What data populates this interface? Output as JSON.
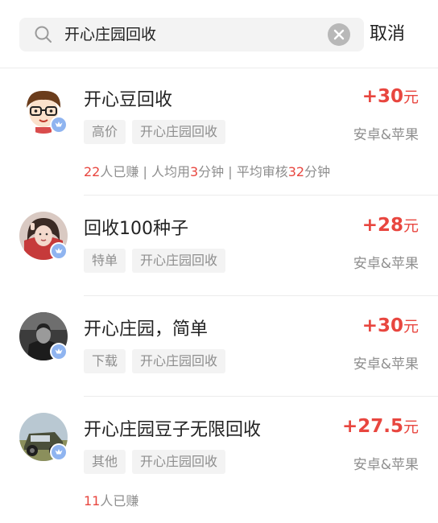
{
  "search": {
    "value": "开心庄园回收",
    "cancel_label": "取消",
    "icons": {
      "search": "search-icon",
      "clear": "clear-icon"
    }
  },
  "colors": {
    "accent": "#e8463f",
    "muted": "#8e8e8e",
    "tag_bg": "#f3f3f3",
    "badge": "#8fb4f0"
  },
  "tasks": [
    {
      "title": "开心豆回收",
      "reward": "+30",
      "reward_unit": "元",
      "tags": [
        "高价",
        "开心庄园回收"
      ],
      "platform": "安卓&苹果",
      "stats": {
        "earned_count": "22",
        "earned_suffix": "人已赚",
        "sep1": " | ",
        "avg_time_prefix": "人均用",
        "avg_time": "3",
        "avg_time_suffix": "分钟",
        "sep2": " | ",
        "review_prefix": "平均审核",
        "review_time": "32",
        "review_suffix": "分钟"
      }
    },
    {
      "title": "回收100种子",
      "reward": "+28",
      "reward_unit": "元",
      "tags": [
        "特单",
        "开心庄园回收"
      ],
      "platform": "安卓&苹果"
    },
    {
      "title": "开心庄园，简单",
      "reward": "+30",
      "reward_unit": "元",
      "tags": [
        "下载",
        "开心庄园回收"
      ],
      "platform": "安卓&苹果"
    },
    {
      "title": "开心庄园豆子无限回收",
      "reward": "+27.5",
      "reward_unit": "元",
      "tags": [
        "其他",
        "开心庄园回收"
      ],
      "platform": "安卓&苹果",
      "stats": {
        "earned_count": "11",
        "earned_suffix": "人已赚"
      }
    }
  ]
}
